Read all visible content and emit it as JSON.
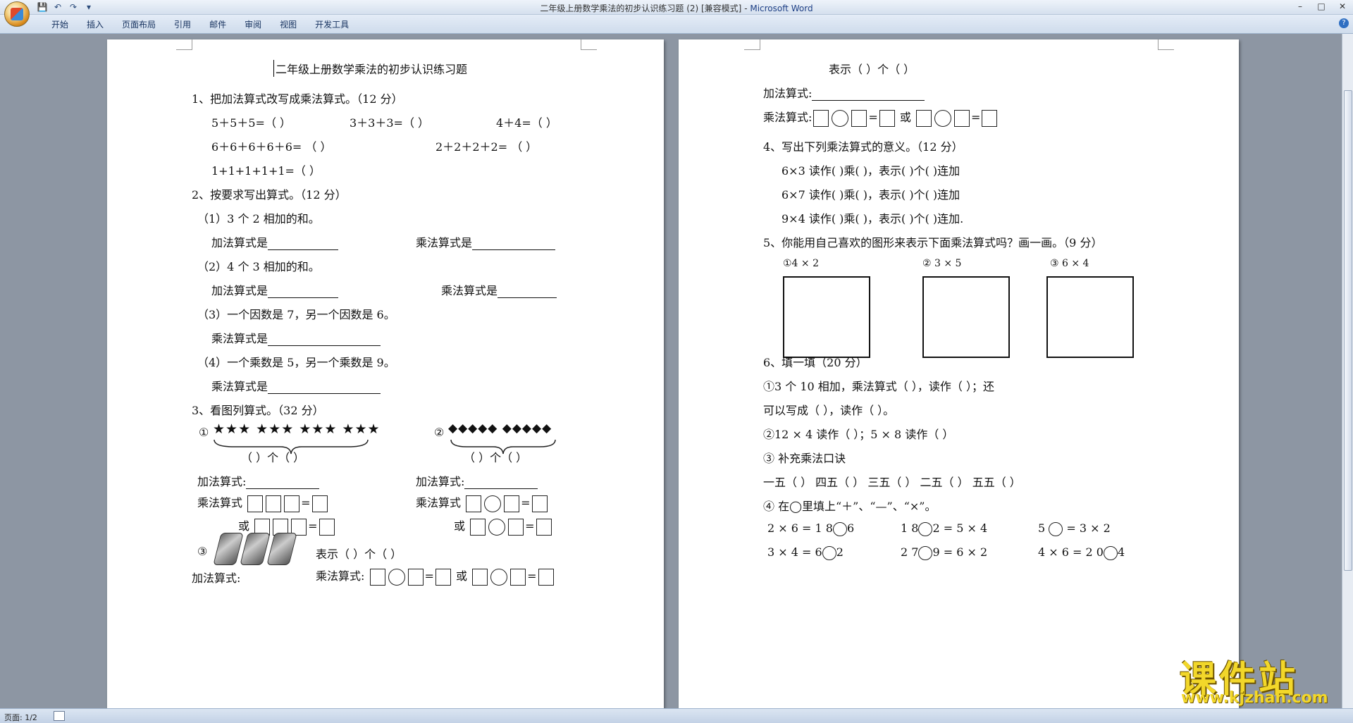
{
  "window": {
    "title": "二年级上册数学乘法的初步认识练习题 (2) [兼容模式]",
    "title_sep": " - ",
    "app": "Microsoft Word"
  },
  "quick_access": {
    "save": "💾",
    "undo": "↶",
    "redo": "↷",
    "more": "▾"
  },
  "window_controls": {
    "minimize": "–",
    "maximize": "□",
    "close": "✕"
  },
  "ribbon": {
    "tabs": [
      "开始",
      "插入",
      "页面布局",
      "引用",
      "邮件",
      "审阅",
      "视图",
      "开发工具"
    ],
    "help": "?"
  },
  "status": {
    "page": "页面: 1/2"
  },
  "page1": {
    "title": "二年级上册数学乘法的初步认识练习题",
    "q1": {
      "head": "1、把加法算式改写成乘法算式。（12 分）",
      "l1a": "5＋5＋5=（         ）",
      "l1b": "3＋3＋3=（         ）",
      "l1c": "4＋4=（         ）",
      "l2a": "6＋6＋6＋6＋6=  （         ）",
      "l2b": "2＋2＋2＋2=  （         ）",
      "l3": "1+1+1+1+1=（         ）"
    },
    "q2": {
      "head": "2、按要求写出算式。（12 分）",
      "s1": "（1）3 个 2 相加的和。",
      "s1_add": "加法算式是",
      "s1_mul": "乘法算式是",
      "s2": "（2）4 个 3 相加的和。",
      "s2_add": "加法算式是",
      "s2_mul": "乘法算式是",
      "s3": "（3）一个因数是 7，另一个因数是 6。",
      "s3_mul": "乘法算式是",
      "s4": "（4）一个乘数是 5，另一个乘数是 9。",
      "s4_mul": "乘法算式是"
    },
    "q3": {
      "head": "3、看图列算式。（32 分）",
      "n1": "①",
      "stars": "★★★   ★★★   ★★★   ★★★",
      "count1": "（     ）个（     ）",
      "n2": "②",
      "diamonds": "◆◆◆◆◆   ◆◆◆◆◆",
      "count2": "（     ）个（     ）",
      "add": "加法算式:",
      "add2": "加法算式:",
      "mul": "乘法算式",
      "mul2": "乘法算式",
      "or": "或",
      "or2": "或",
      "n3": "③",
      "show3": "表示（     ）个（     ）",
      "add3": "加法算式:",
      "mul3": "乘法算式:",
      "or3": "或"
    }
  },
  "page2": {
    "show": "表示（   ）个（   ）",
    "add": "加法算式:",
    "mul": "乘法算式:",
    "or": "或",
    "q4": {
      "head": "4、写出下列乘法算式的意义。（12 分）",
      "r1": "6×3 读作(      )乘(      )，表示(      )个(      )连加",
      "r2": "6×7 读作(      )乘(      )，表示(      )个(      )连加",
      "r3": "9×4 读作(      )乘(      )，表示(      )个(      )连加."
    },
    "q5": {
      "head": "5、你能用自己喜欢的图形来表示下面乘法算式吗？画一画。（9 分）",
      "e1": "①4   ×   2",
      "e2": "② 3   ×   5",
      "e3": "③ 6   ×   4"
    },
    "q6": {
      "head": "6、填一填（20 分）",
      "a1": "①3 个 10 相加，乘法算式（              ），读作（                   ）；还",
      "a2": "可以写成（              ），读作（                    ）。",
      "b": "②12 × 4 读作（            ）；5 × 8 读作（            ）",
      "c": "③ 补充乘法口诀",
      "c_items": "一五（      ）   四五（      ）   三五（      ）   二五（      ）   五五（      ）",
      "d": "④   在◯里填上“＋”、“—”、“×”。",
      "d1a": "2 × 6 = 1  8",
      "d1a2": "6",
      "d1b": "1  8",
      "d1b2": "2 = 5 × 4",
      "d1c": "5",
      "d1c2": "= 3 × 2",
      "d2a": "3 × 4 = 6",
      "d2a2": "2",
      "d2b": "2  7",
      "d2b2": "9 = 6 × 2",
      "d2c": "4 × 6 = 2  0",
      "d2c2": "4"
    }
  },
  "watermark": {
    "big": "课件站",
    "url": "www.kjzhan.com"
  }
}
